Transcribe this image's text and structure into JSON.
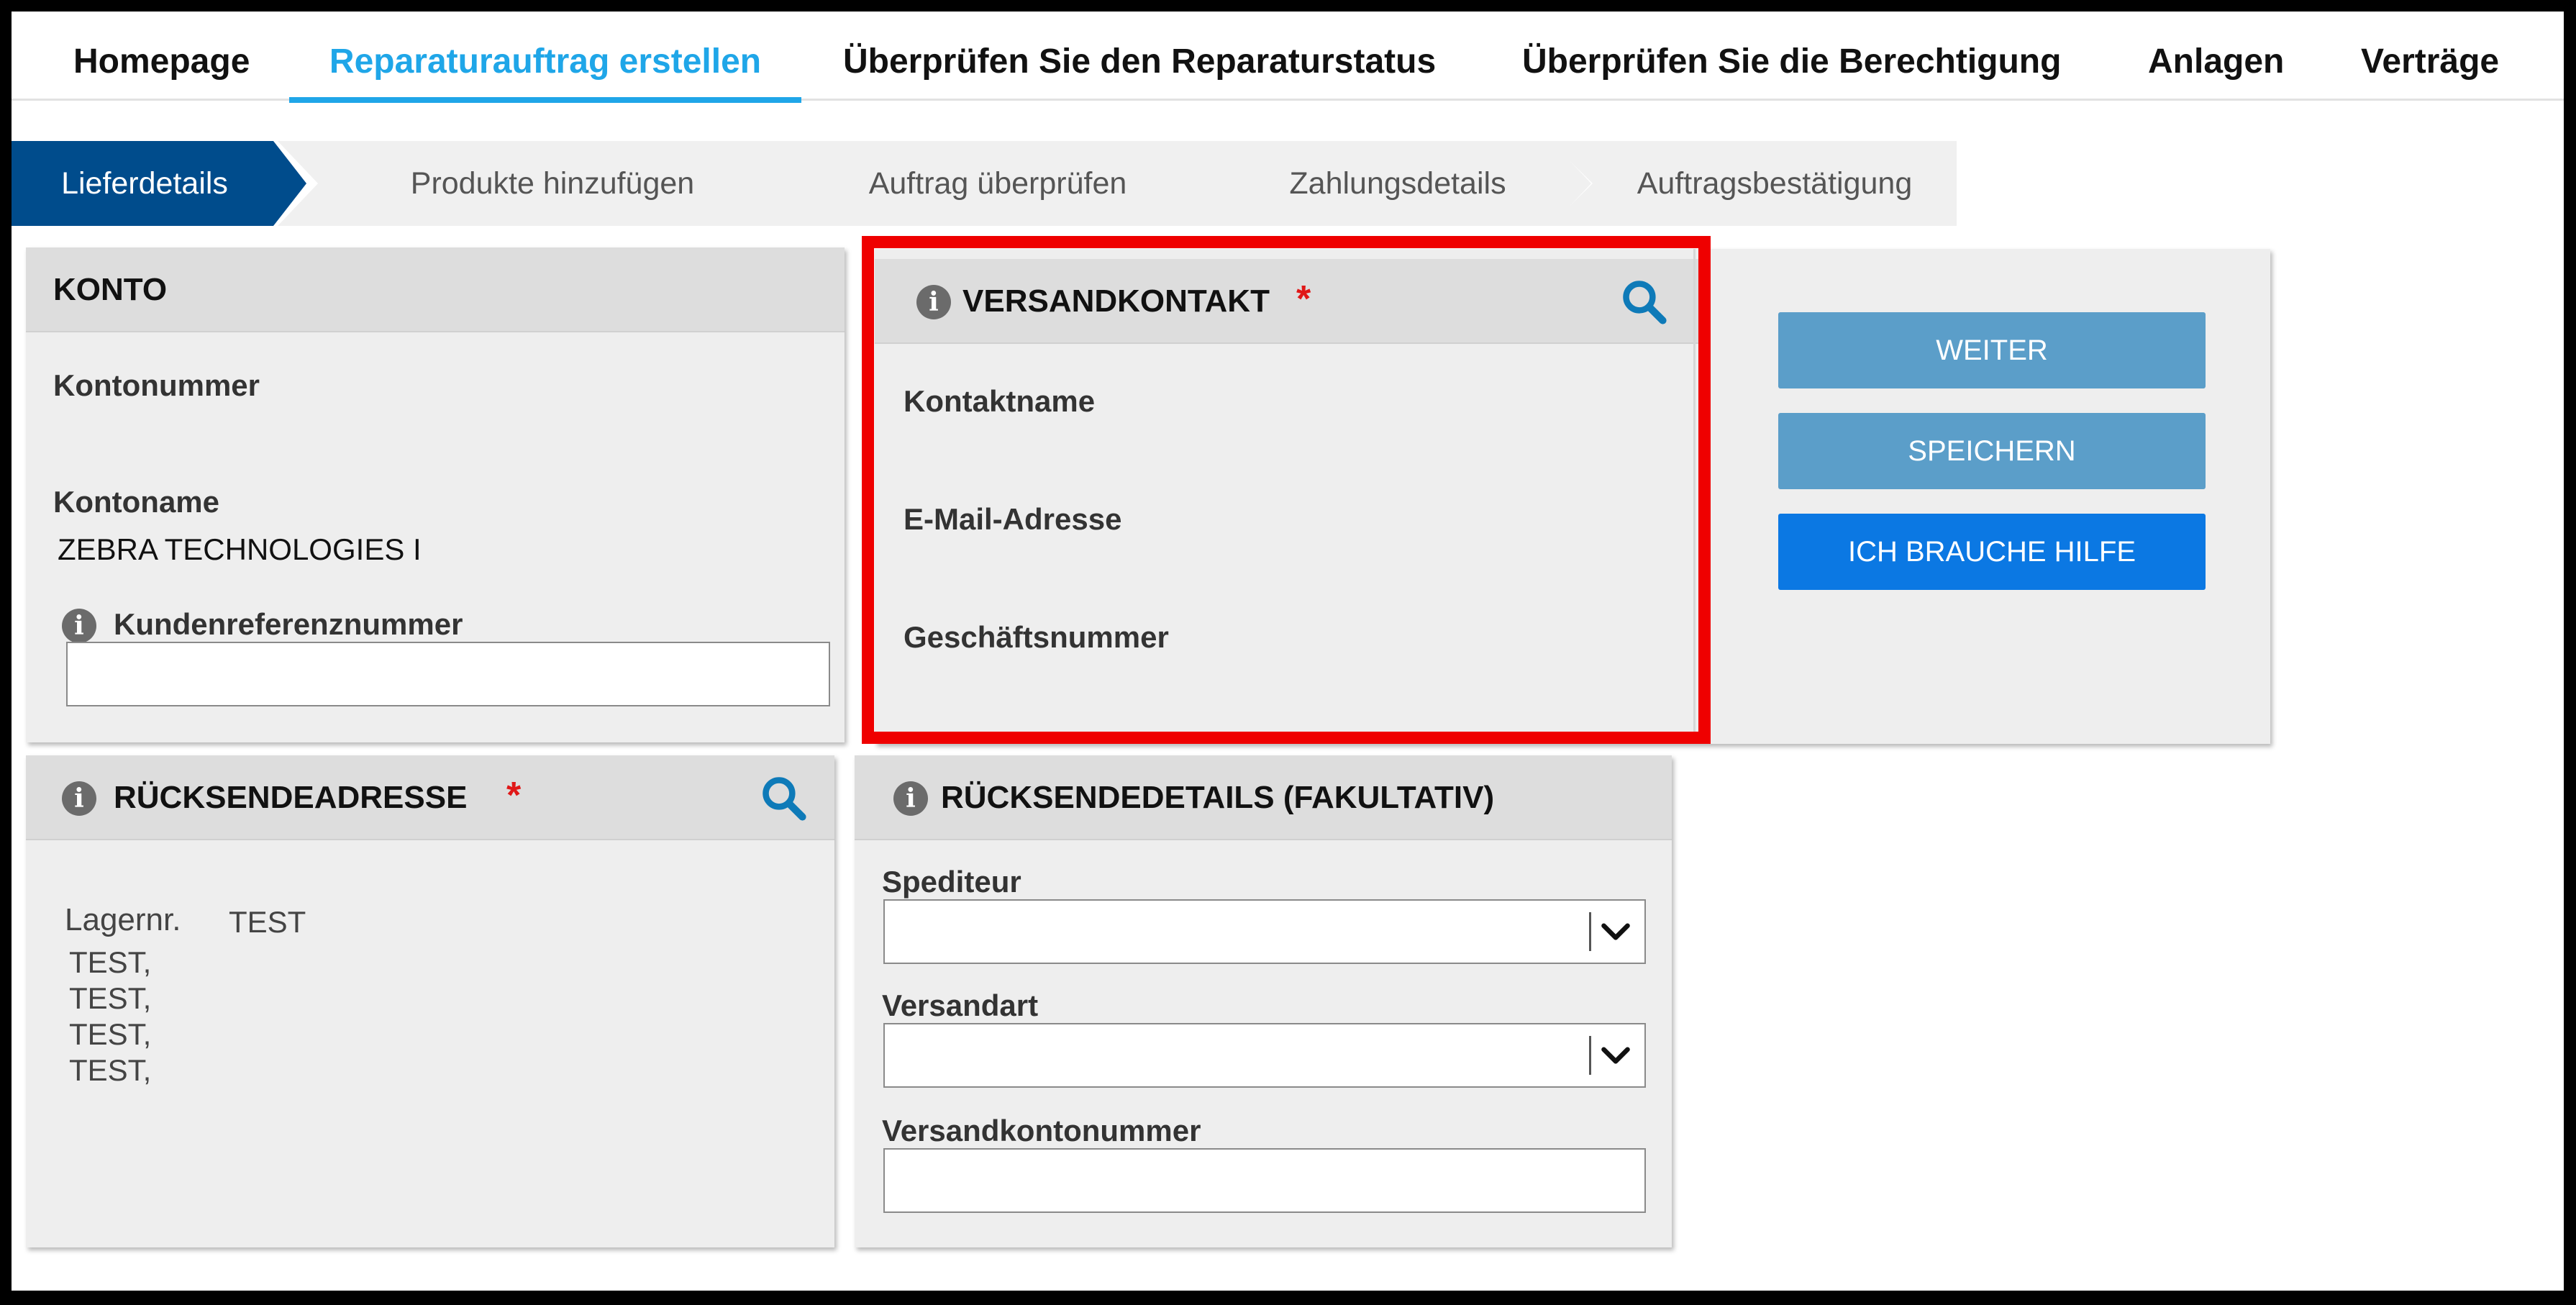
{
  "nav": {
    "items": [
      {
        "label": "Homepage"
      },
      {
        "label": "Reparaturauftrag erstellen"
      },
      {
        "label": "Überprüfen Sie den Reparaturstatus"
      },
      {
        "label": "Überprüfen Sie die Berechtigung"
      },
      {
        "label": "Anlagen"
      },
      {
        "label": "Verträge"
      }
    ],
    "active_index": 1
  },
  "steps": [
    {
      "label": "Lieferdetails"
    },
    {
      "label": "Produkte hinzufügen"
    },
    {
      "label": "Auftrag überprüfen"
    },
    {
      "label": "Zahlungsdetails"
    },
    {
      "label": "Auftragsbestätigung"
    }
  ],
  "konto": {
    "title": "KONTO",
    "account_number_label": "Kontonummer",
    "account_number_value": "",
    "account_name_label": "Kontoname",
    "account_name_value": "ZEBRA TECHNOLOGIES I",
    "customer_ref_label": "Kundenreferenznummer",
    "customer_ref_value": "",
    "customer_ref_placeholder": ""
  },
  "versandkontakt": {
    "title": "VERSANDKONTAKT",
    "required_mark": "*",
    "contact_name_label": "Kontaktname",
    "contact_name_value": "",
    "email_label": "E-Mail-Adresse",
    "email_value": "",
    "phone_label": "Geschäftsnummer",
    "phone_value": ""
  },
  "actions": {
    "weiter_label": "WEITER",
    "speichern_label": "SPEICHERN",
    "hilfe_label": "ICH BRAUCHE HILFE"
  },
  "ruecksendeadresse": {
    "title": "RÜCKSENDEADRESSE",
    "required_mark": "*",
    "warehouse_label": "Lagernr.",
    "warehouse_value": "TEST",
    "address_lines": [
      "TEST,",
      "TEST,",
      "TEST,",
      "TEST,"
    ]
  },
  "ruecksendedetails": {
    "title": "RÜCKSENDEDETAILS (FAKULTATIV)",
    "carrier_label": "Spediteur",
    "carrier_value": "",
    "shipping_method_label": "Versandart",
    "shipping_method_value": "",
    "shipping_account_label": "Versandkontonummer",
    "shipping_account_value": ""
  },
  "colors": {
    "accent": "#1fa6e8",
    "step_active": "#004c8c",
    "button_light": "#5b9ec9",
    "button_bright": "#0b78e3",
    "required": "#e01818",
    "highlight": "#ef0000",
    "search_icon": "#0e7ab8"
  },
  "icons": {
    "info": "info-icon",
    "search": "search-icon",
    "dropdown": "chevron-down-icon"
  }
}
